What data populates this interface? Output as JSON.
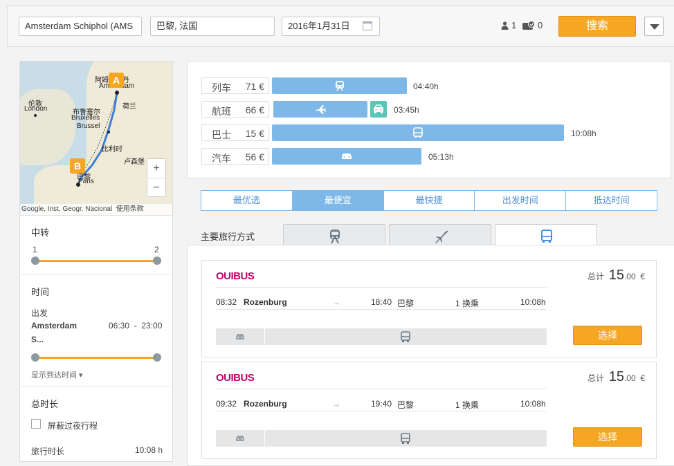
{
  "search": {
    "from": "Amsterdam Schiphol (AMS",
    "to": "巴黎, 法国",
    "date": "2016年1月31日",
    "passengers": "1",
    "discount_cards": "0",
    "search_label": "搜索"
  },
  "map": {
    "labels": [
      "阿姆斯特丹",
      "Amsterdam",
      "伦敦",
      "London",
      "荷兰",
      "布鲁塞尔",
      "Bruxelles",
      "Brussel",
      "比利时",
      "卢森堡",
      "巴黎",
      "Paris"
    ],
    "marker_a": "A",
    "marker_b": "B",
    "attribution": "Google, Inst. Geogr. Nacional",
    "terms": "使用条款",
    "google": "Google",
    "zoom_in": "+",
    "zoom_out": "−"
  },
  "filters": {
    "transfers": {
      "title": "中转",
      "min": "1",
      "max": "2"
    },
    "time": {
      "title": "时间",
      "depart_label": "出发",
      "depart_place": "Amsterdam",
      "depart_place2": "S...",
      "range": "06:30  -  23:00",
      "toggle": "显示到达时间 ▾"
    },
    "duration": {
      "title": "总时长",
      "hide_overnight": "屏蔽过夜行程",
      "travel_time_label": "旅行时长",
      "travel_time": "10:08 h"
    }
  },
  "modes": [
    {
      "name": "列车",
      "price": "71 €",
      "duration": "04:40h",
      "icon": "train-icon",
      "ratio": 0.46
    },
    {
      "name": "航班",
      "price": "66 €",
      "duration": "03:45h",
      "icon": "plane-icon",
      "ratio": 0.37
    },
    {
      "name": "巴士",
      "price": "15 €",
      "duration": "10:08h",
      "icon": "bus-icon",
      "ratio": 1.0
    },
    {
      "name": "汽车",
      "price": "56 €",
      "duration": "05:13h",
      "icon": "car-icon",
      "ratio": 0.51
    }
  ],
  "sort": [
    "最优选",
    "最便宜",
    "最快捷",
    "出发时间",
    "抵达时间"
  ],
  "sort_active": "最便宜",
  "tabs": {
    "label": "主要旅行方式",
    "items": [
      "train-icon",
      "plane-icon",
      "bus-icon"
    ],
    "active": "bus-icon"
  },
  "results": [
    {
      "operator": "OUIBUS",
      "total_label": "总计",
      "price_int": "15",
      "price_dec": ".00",
      "currency": "€",
      "dep": "08:32",
      "from": "Rozenburg",
      "arr": "18:40",
      "to": "巴黎",
      "transfers": "1 换乘",
      "duration": "10:08h",
      "select": "选择"
    },
    {
      "operator": "OUIBUS",
      "total_label": "总计",
      "price_int": "15",
      "price_dec": ".00",
      "currency": "€",
      "dep": "09:32",
      "from": "Rozenburg",
      "arr": "19:40",
      "to": "巴黎",
      "transfers": "1 换乘",
      "duration": "10:08h",
      "select": "选择"
    }
  ],
  "colors": {
    "accent": "#f5a623",
    "bar": "#7db8e8",
    "operator": "#c3006b"
  }
}
